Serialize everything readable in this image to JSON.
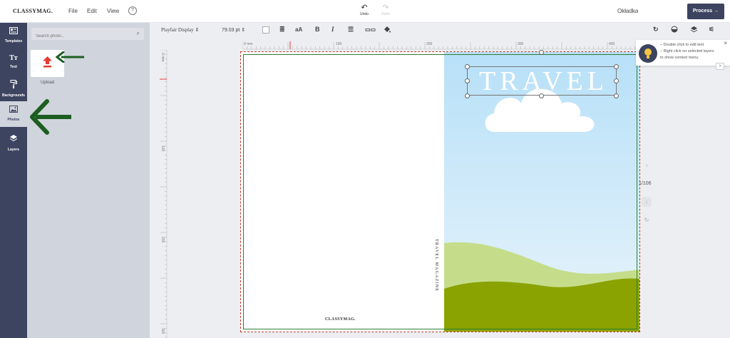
{
  "app": {
    "logo": "CLASSYMAG.",
    "menu": [
      "File",
      "Edit",
      "View"
    ],
    "help_icon": "?",
    "undo_label": "Undo",
    "redo_label": "Redo",
    "document_name": "Okładka",
    "process_label": "Process",
    "process_arrow": "→"
  },
  "sidebar": {
    "items": [
      {
        "label": "Templates",
        "icon": "templates-icon"
      },
      {
        "label": "Text",
        "icon": "text-icon"
      },
      {
        "label": "Backgrounds",
        "icon": "paint-roller-icon"
      },
      {
        "label": "Photos",
        "icon": "photo-icon"
      },
      {
        "label": "Layers",
        "icon": "layers-icon"
      }
    ]
  },
  "panel": {
    "search_placeholder": "Search photo...",
    "upload_label": "Upload"
  },
  "toolbar": {
    "font_name": "Playfair Display",
    "font_size": "79.03",
    "font_unit": "pt",
    "bold": "B",
    "italic": "I",
    "case_icon": "aA"
  },
  "ruler": {
    "top_labels": [
      "0 mm",
      "100",
      "200",
      "300",
      "400"
    ],
    "left_labels": [
      "0 mm",
      "100",
      "200",
      "300"
    ]
  },
  "canvas": {
    "title_text": "TRAVEL",
    "spine_text": "TRAVEL MAGAZINE",
    "footer_logo": "CLASSYMAG."
  },
  "hint": {
    "lines": [
      "– Double click to edit text",
      "– Right click on selected layers",
      "to show context menu"
    ],
    "close": "×",
    "chevron": "›"
  },
  "page_indicator": "1/106",
  "colors": {
    "accent": "#3c4460",
    "panel": "#d0d4dc",
    "sky_top": "#b7e0f8",
    "hill_light": "#c5dd8b",
    "hill_dark": "#8aa300",
    "annotation": "#1b5e20",
    "upload_red": "#e53935"
  }
}
